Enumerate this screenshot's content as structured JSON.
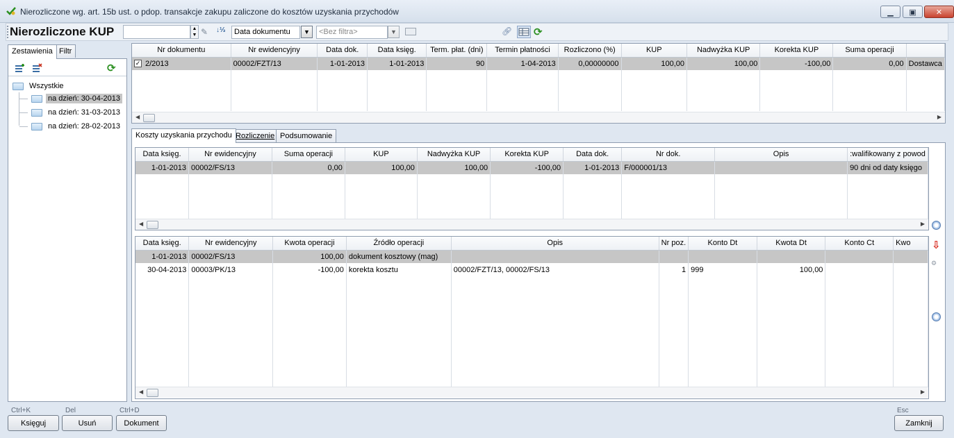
{
  "window": {
    "title": "Nierozliczone wg. art. 15b ust. o pdop. transakcje zakupu zaliczone do kosztów uzyskania przychodów"
  },
  "toolbar": {
    "title": "Nierozliczone KUP",
    "sort_value": "Data dokumentu",
    "filter_placeholder": "<Bez filtra>"
  },
  "left_tabs": [
    "Zestawienia",
    "Filtr"
  ],
  "tree": {
    "root": "Wszystkie",
    "items": [
      "na dzień: 30-04-2013",
      "na dzień: 31-03-2013",
      "na dzień: 28-02-2013"
    ]
  },
  "top_grid": {
    "columns": [
      "Nr dokumentu",
      "Nr ewidencyjny",
      "Data dok.",
      "Data księg.",
      "Term. płat. (dni)",
      "Termin płatności",
      "Rozliczono (%)",
      "KUP",
      "Nadwyżka KUP",
      "Korekta KUP",
      "Suma operacji",
      ""
    ],
    "rows": [
      [
        "2/2013",
        "00002/FZT/13",
        "1-01-2013",
        "1-01-2013",
        "90",
        "1-04-2013",
        "0,00000000",
        "100,00",
        "100,00",
        "-100,00",
        "0,00",
        "Dostawca"
      ]
    ]
  },
  "detail_tabs": [
    "Koszty uzyskania przychodu",
    "Rozliczenie",
    "Podsumowanie"
  ],
  "kup_grid": {
    "columns": [
      "Data księg.",
      "Nr ewidencyjny",
      "Suma operacji",
      "KUP",
      "Nadwyżka KUP",
      "Korekta KUP",
      "Data dok.",
      "Nr dok.",
      "Opis",
      ":walifikowany z powod"
    ],
    "rows": [
      [
        "1-01-2013",
        "00002/FS/13",
        "0,00",
        "100,00",
        "100,00",
        "-100,00",
        "1-01-2013",
        "F/000001/13",
        "",
        "90 dni od daty księgo"
      ]
    ]
  },
  "ops_grid": {
    "columns": [
      "Data księg.",
      "Nr ewidencyjny",
      "Kwota operacji",
      "Źródło operacji",
      "Opis",
      "Nr poz.",
      "Konto Dt",
      "Kwota Dt",
      "Konto Ct",
      "Kwo"
    ],
    "rows": [
      [
        "1-01-2013",
        "00002/FS/13",
        "100,00",
        "dokument kosztowy (mag)",
        "",
        "",
        "",
        "",
        "",
        ""
      ],
      [
        "30-04-2013",
        "00003/PK/13",
        "-100,00",
        "korekta kosztu",
        "00002/FZT/13, 00002/FS/13",
        "1",
        "999",
        "100,00",
        "",
        ""
      ]
    ]
  },
  "footer": {
    "buttons": [
      {
        "shortcut": "Ctrl+K",
        "label": "Księguj"
      },
      {
        "shortcut": "Del",
        "label": "Usuń"
      },
      {
        "shortcut": "Ctrl+D",
        "label": "Dokument"
      }
    ],
    "close": {
      "shortcut": "Esc",
      "label": "Zamknij"
    }
  },
  "colors": {
    "selection": "#c6c6c6",
    "background": "#dfe7f1",
    "accent": "#2a8f1f"
  }
}
